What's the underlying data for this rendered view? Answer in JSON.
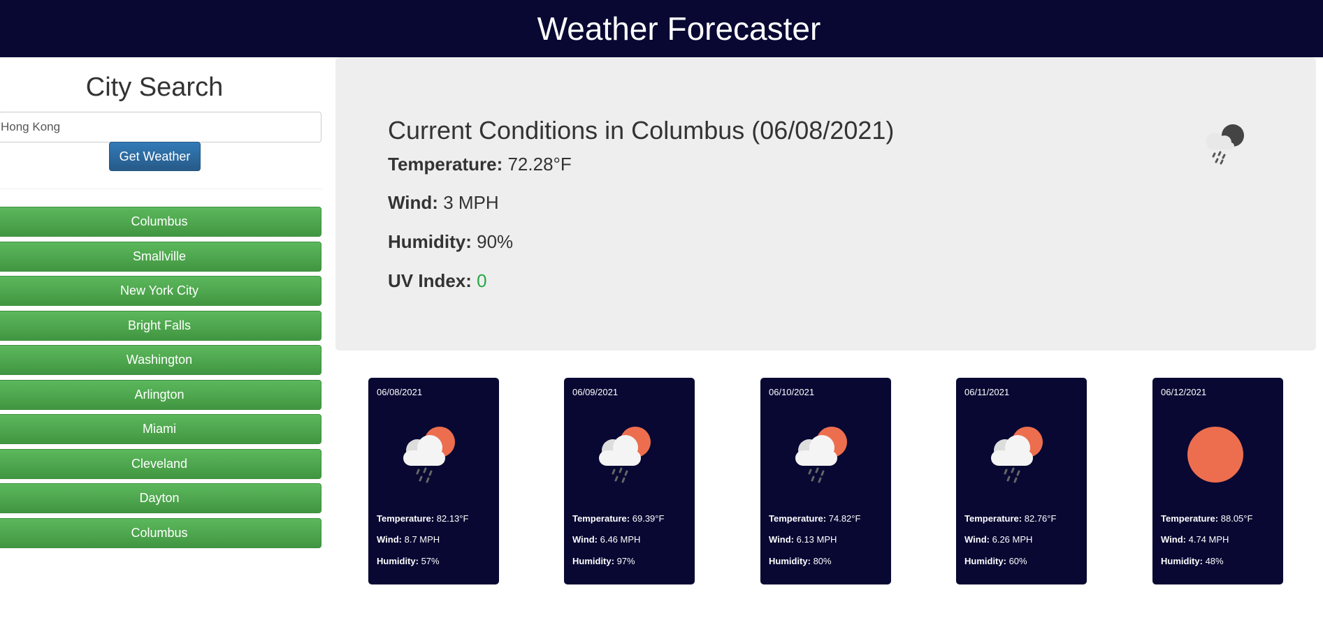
{
  "header": {
    "title": "Weather Forecaster"
  },
  "search": {
    "title": "City Search",
    "input_value": "Hong Kong",
    "button_label": "Get Weather"
  },
  "history": [
    "Columbus",
    "Smallville",
    "New York City",
    "Bright Falls",
    "Washington",
    "Arlington",
    "Miami",
    "Cleveland",
    "Dayton",
    "Columbus"
  ],
  "current": {
    "title": "Current Conditions in Columbus (06/08/2021)",
    "temperature_label": "Temperature:",
    "temperature_value": "72.28°F",
    "wind_label": "Wind:",
    "wind_value": "3 MPH",
    "humidity_label": "Humidity:",
    "humidity_value": "90%",
    "uv_label": "UV Index:",
    "uv_value": "0",
    "icon": "night-rain-icon"
  },
  "forecast": [
    {
      "date": "06/08/2021",
      "icon": "sun-cloud-rain-icon",
      "temperature": "82.13°F",
      "wind": "8.7 MPH",
      "humidity": "57%"
    },
    {
      "date": "06/09/2021",
      "icon": "sun-cloud-rain-icon",
      "temperature": "69.39°F",
      "wind": "6.46 MPH",
      "humidity": "97%"
    },
    {
      "date": "06/10/2021",
      "icon": "sun-cloud-rain-icon",
      "temperature": "74.82°F",
      "wind": "6.13 MPH",
      "humidity": "80%"
    },
    {
      "date": "06/11/2021",
      "icon": "sun-cloud-rain-icon",
      "temperature": "82.76°F",
      "wind": "6.26 MPH",
      "humidity": "60%"
    },
    {
      "date": "06/12/2021",
      "icon": "sun-icon",
      "temperature": "88.05°F",
      "wind": "4.74 MPH",
      "humidity": "48%"
    }
  ],
  "labels": {
    "temperature": "Temperature:",
    "wind": "Wind:",
    "humidity": "Humidity:"
  },
  "colors": {
    "header_bg": "#080833",
    "history_green": "#4cae4c",
    "button_blue": "#337ab7",
    "uv_green": "#28a745",
    "sun": "#ed6e4e"
  }
}
